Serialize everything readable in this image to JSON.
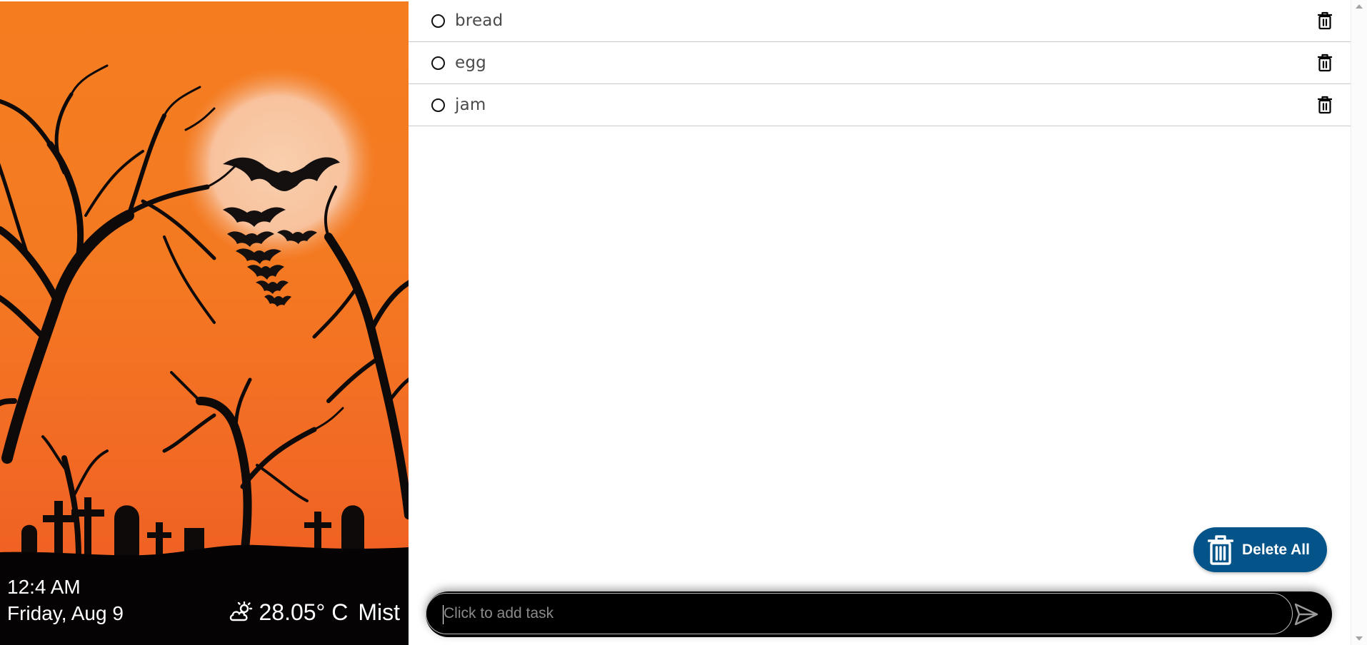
{
  "clock": {
    "time": "12:4 AM",
    "date": "Friday, Aug 9"
  },
  "weather": {
    "icon": "partly-cloudy-icon",
    "temperature": "28.05° C",
    "condition": "Mist"
  },
  "tasks": [
    {
      "label": "bread",
      "done": false
    },
    {
      "label": "egg",
      "done": false
    },
    {
      "label": "jam",
      "done": false
    }
  ],
  "actions": {
    "delete_all_label": "Delete All"
  },
  "add_task": {
    "placeholder": "Click to add task",
    "value": ""
  },
  "colors": {
    "sky_top": "#f57d1f",
    "sky_bottom": "#ee5a22",
    "moon": "#f8c4a0",
    "delete_all_bg": "#04548a",
    "input_bg": "#000000"
  }
}
